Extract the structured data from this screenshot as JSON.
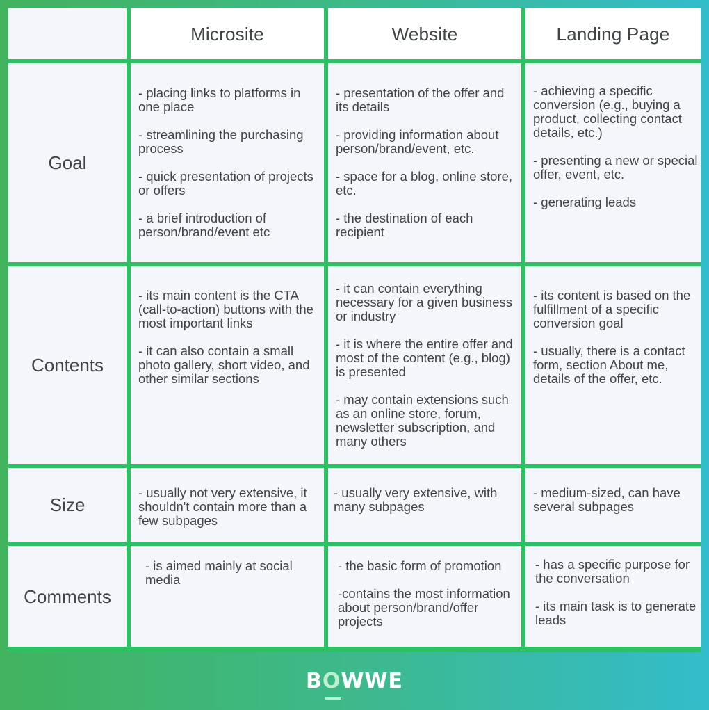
{
  "columns": [
    "",
    "Microsite",
    "Website",
    "Landing Page"
  ],
  "rows": [
    {
      "label": "Goal",
      "cells": [
        [
          "- placing links to platforms in one place",
          "- streamlining the purchasing process",
          "- quick presentation of projects or offers",
          "- a brief introduction of person/brand/event etc"
        ],
        [
          "- presentation of the offer and its details",
          "- providing information about person/brand/event, etc.",
          "- space for a blog, online store, etc.",
          "- the destination of each recipient"
        ],
        [
          "- achieving a specific conversion (e.g., buying a product, collecting contact details, etc.)",
          "- presenting a new or special offer, event, etc.",
          "- generating leads"
        ]
      ]
    },
    {
      "label": "Contents",
      "cells": [
        [
          "- its main content is the CTA (call-to-action) buttons with the most important links",
          "- it can also contain a small photo gallery, short video, and other similar sections"
        ],
        [
          "- it can contain everything necessary for a given business or industry",
          "- it is where the entire offer and most of the content (e.g., blog) is presented",
          "- may contain extensions such as an online store, forum, newsletter subscription, and many others"
        ],
        [
          "- its content is based on the fulfillment of a specific conversion goal",
          "- usually, there is a contact form, section About me, details of the offer, etc."
        ]
      ]
    },
    {
      "label": "Size",
      "cells": [
        [
          "- usually not very extensive, it shouldn't contain more than a few subpages"
        ],
        [
          "- usually very extensive, with many subpages"
        ],
        [
          "- medium-sized, can  have several subpages"
        ]
      ]
    },
    {
      "label": "Comments",
      "cells": [
        [
          "- is aimed mainly at social media"
        ],
        [
          "- the basic form of promotion",
          "-contains the most information about person/brand/offer projects"
        ],
        [
          "- has a specific purpose for the conversation",
          "- its main task is to generate leads"
        ]
      ]
    }
  ],
  "footer": {
    "logo_prefix": "B",
    "logo_o": "O",
    "logo_suffix": "WWE"
  },
  "colors": {
    "grid_line": "#2ec163",
    "cell_bg": "#f5f6fb",
    "header_bg": "#ffffff",
    "text": "#3f4547",
    "bg_left": "#41b35e",
    "bg_right": "#33bccb"
  }
}
